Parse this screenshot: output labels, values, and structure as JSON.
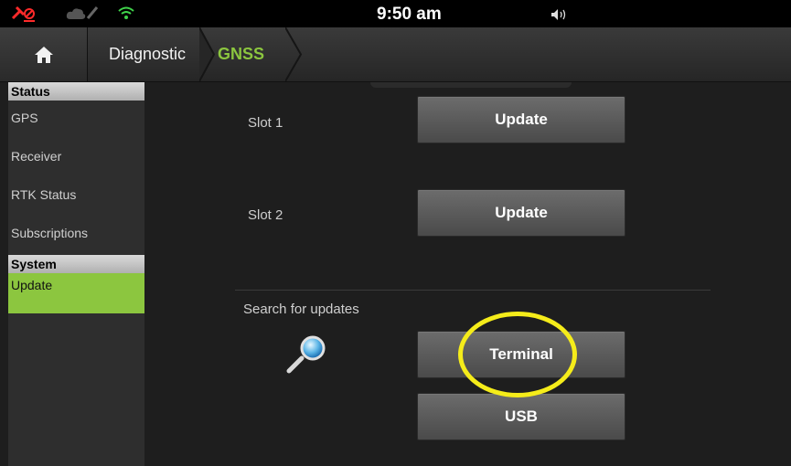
{
  "status_bar": {
    "time": "9:50 am",
    "icons": [
      "gps-off-icon",
      "no-signal-icon",
      "cloud-icon",
      "satellite-icon",
      "wifi-icon",
      "speaker-icon"
    ],
    "colors": {
      "gps_off": "#ff2a2a",
      "wifi": "#3fd24a"
    }
  },
  "navbar": {
    "home_icon": "home-icon",
    "breadcrumb": [
      {
        "label": "Diagnostic"
      },
      {
        "label": "GNSS"
      }
    ],
    "active_color": "#8cc63f"
  },
  "sidebar": {
    "sections": [
      {
        "header": "Status",
        "items": [
          "GPS",
          "Receiver",
          "RTK Status",
          "Subscriptions"
        ]
      },
      {
        "header": "System",
        "items": [
          "Update"
        ]
      }
    ],
    "active_item": "Update",
    "active_color": "#8cc63f"
  },
  "main": {
    "slot1": {
      "label": "Slot 1",
      "button": "Update"
    },
    "slot2": {
      "label": "Slot 2",
      "button": "Update"
    },
    "search": {
      "label": "Search for updates",
      "icon": "magnifier-icon"
    },
    "terminal_button": "Terminal",
    "usb_button": "USB",
    "highlight_color": "#f5ec1a"
  }
}
